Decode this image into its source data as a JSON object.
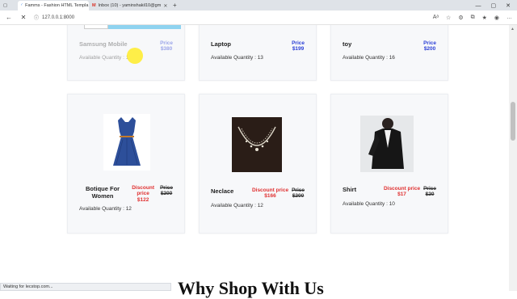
{
  "browser": {
    "tabs": [
      {
        "title": "Famms - Fashion HTML Templa",
        "active": true
      },
      {
        "title": "Inbox (10) - yaminshakil10@gm",
        "active": false
      }
    ],
    "address": "127.0.0.1:8000",
    "status_text": "Waiting for lecstop.com..."
  },
  "products_top": [
    {
      "name": "Samsung Mobile",
      "price_label": "Price",
      "price": "$380",
      "quantity_label": "Available Quantity : 1",
      "faded": true
    },
    {
      "name": "Laptop",
      "price_label": "Price",
      "price": "$199",
      "quantity_label": "Available Quantity : 13",
      "faded": false
    },
    {
      "name": "toy",
      "price_label": "Price",
      "price": "$200",
      "quantity_label": "Available Quantity : 16",
      "faded": false
    }
  ],
  "products_bottom": [
    {
      "name": "Botique For Women",
      "discount_label": "Discount price",
      "discount_price": "$122",
      "price_label": "Price",
      "old_price": "$200",
      "quantity_label": "Available Quantity : 12",
      "image": "dress-image"
    },
    {
      "name": "Neclace",
      "discount_label": "Discount price",
      "discount_price": "$166",
      "price_label": "Price",
      "old_price": "$200",
      "quantity_label": "Available Quantity : 12",
      "image": "necklace-image"
    },
    {
      "name": "Shirt",
      "discount_label": "Discount price",
      "discount_price": "$17",
      "price_label": "Price",
      "old_price": "$20",
      "quantity_label": "Available Quantity : 10",
      "image": "shirt-image"
    }
  ],
  "section_heading": "Why Shop With Us",
  "colors": {
    "price_blue": "#2b3fd6",
    "discount_red": "#e03030",
    "card_bg": "#f7f8fa"
  }
}
